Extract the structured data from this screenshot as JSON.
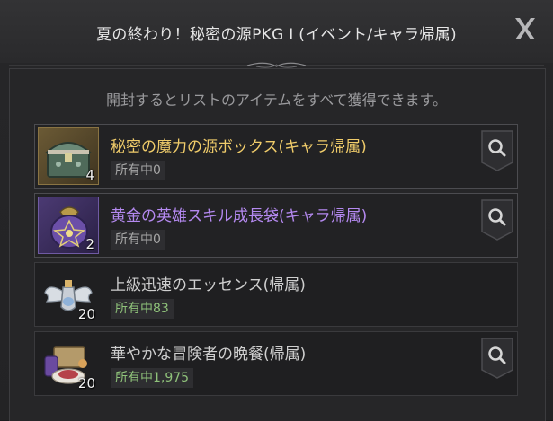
{
  "dialog": {
    "title": "夏の終わり！秘密の源PKG I (イベント/キャラ帰属)",
    "close_icon": "close-x-icon",
    "notice": "開封するとリストのアイテムをすべて獲得できます。"
  },
  "items": [
    {
      "name": "秘密の魔力の源ボックス(キャラ帰属)",
      "quantity": "4",
      "owned": "所有中0",
      "name_color": "#f0cc6a",
      "icon": "treasure-chest-icon",
      "has_search": true
    },
    {
      "name": "黄金の英雄スキル成長袋(キャラ帰属)",
      "quantity": "2",
      "owned": "所有中0",
      "name_color": "#b489f0",
      "icon": "pouch-icon",
      "has_search": true
    },
    {
      "name": "上級迅速のエッセンス(帰属)",
      "quantity": "20",
      "owned": "所有中83",
      "name_color": "#cfcfcf",
      "icon": "winged-essence-icon",
      "has_search": false
    },
    {
      "name": "華やかな冒険者の晩餐(帰属)",
      "quantity": "20",
      "owned": "所有中1,975",
      "name_color": "#cfcfcf",
      "icon": "feast-icon",
      "has_search": true
    }
  ]
}
